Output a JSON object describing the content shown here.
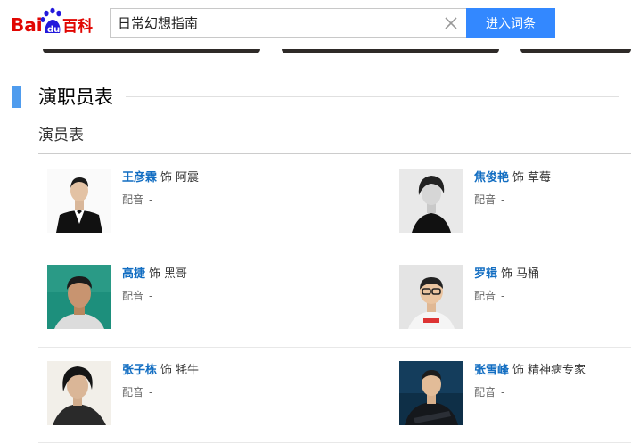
{
  "header": {
    "logo_text": "Baidu百科",
    "search_value": "日常幻想指南",
    "enter_button": "进入词条"
  },
  "section": {
    "title": "演职员表",
    "subtitle": "演员表"
  },
  "cast": [
    {
      "actor": "王彦霖",
      "role_prefix": "饰",
      "role": "阿震",
      "dub_label": "配音",
      "dub_value": "-"
    },
    {
      "actor": "焦俊艳",
      "role_prefix": "饰",
      "role": "草莓",
      "dub_label": "配音",
      "dub_value": "-"
    },
    {
      "actor": "高捷",
      "role_prefix": "饰",
      "role": "黑哥",
      "dub_label": "配音",
      "dub_value": "-"
    },
    {
      "actor": "罗辑",
      "role_prefix": "饰",
      "role": "马桶",
      "dub_label": "配音",
      "dub_value": "-"
    },
    {
      "actor": "张子栋",
      "role_prefix": "饰",
      "role": "牦牛",
      "dub_label": "配音",
      "dub_value": "-"
    },
    {
      "actor": "张雪峰",
      "role_prefix": "饰",
      "role": "精神病专家",
      "dub_label": "配音",
      "dub_value": "-"
    }
  ],
  "colors": {
    "brand_red": "#e10602",
    "brand_blue": "#2319dc",
    "button_blue": "#3388ff",
    "link_blue": "#136ec2",
    "section_marker": "#4f9cee"
  },
  "icons": {
    "clear": "close-icon",
    "logo": "baidu-paw-logo"
  }
}
